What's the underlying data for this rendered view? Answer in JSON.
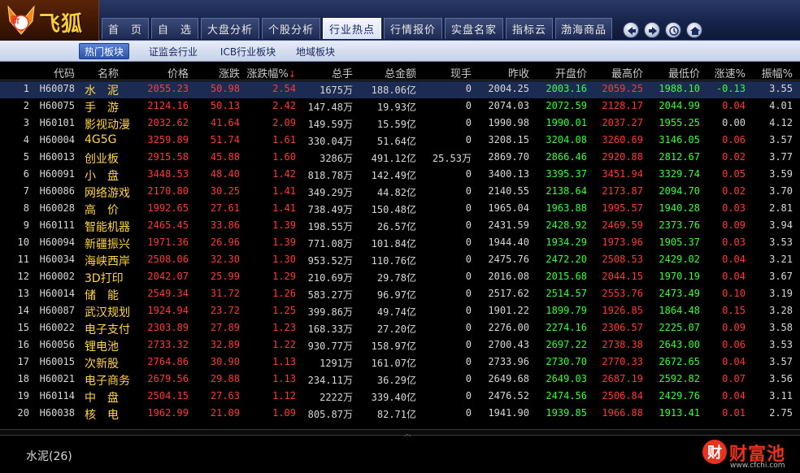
{
  "app": {
    "logo_badge": "新",
    "logo_text": "飞狐"
  },
  "nav": {
    "tabs": [
      "首　页",
      "自　选",
      "大盘分析",
      "个股分析",
      "行业热点",
      "行情报价",
      "实盘名家",
      "指标云",
      "渤海商品"
    ],
    "active_index": 4,
    "buttons": [
      "back-icon",
      "forward-icon",
      "clock-icon",
      "home-icon"
    ]
  },
  "subnav": {
    "tabs": [
      "热门板块",
      "证监会行业",
      "ICB行业板块",
      "地域板块"
    ],
    "active_index": 0
  },
  "table": {
    "columns": [
      "代码",
      "名称",
      "价格",
      "涨跌",
      "涨跌幅%",
      "总手",
      "总金额",
      "现手",
      "昨收",
      "开盘价",
      "最高价",
      "最低价",
      "涨速%",
      "振幅%"
    ],
    "sorted_column": "涨跌幅%",
    "sort_indicator": "↓",
    "rows": [
      {
        "idx": "1",
        "code": "H60078",
        "name": "水　泥",
        "price": "2055.23",
        "chg": "50.98",
        "pct": "2.54",
        "vol": "1675万",
        "amt": "188.06亿",
        "cur": "0",
        "prev": "2004.25",
        "open": "2003.16",
        "high": "2059.25",
        "low": "1988.10",
        "speed": "-0.13",
        "amp": "3.55",
        "open_c": "green",
        "high_c": "red",
        "low_c": "green",
        "speed_c": "green"
      },
      {
        "idx": "2",
        "code": "H60075",
        "name": "手　游",
        "price": "2124.16",
        "chg": "50.13",
        "pct": "2.42",
        "vol": "147.48万",
        "amt": "19.93亿",
        "cur": "0",
        "prev": "2074.03",
        "open": "2072.59",
        "high": "2128.17",
        "low": "2044.99",
        "speed": "0.04",
        "amp": "4.01",
        "open_c": "green",
        "high_c": "red",
        "low_c": "green",
        "speed_c": "red"
      },
      {
        "idx": "3",
        "code": "H60101",
        "name": "影视动漫",
        "price": "2032.62",
        "chg": "41.64",
        "pct": "2.09",
        "vol": "149.59万",
        "amt": "15.59亿",
        "cur": "0",
        "prev": "1990.98",
        "open": "1990.01",
        "high": "2037.27",
        "low": "1955.25",
        "speed": "0.00",
        "amp": "4.12",
        "open_c": "green",
        "high_c": "red",
        "low_c": "green",
        "speed_c": "white"
      },
      {
        "idx": "4",
        "code": "H60004",
        "name": "4G5G",
        "price": "3259.89",
        "chg": "51.74",
        "pct": "1.61",
        "vol": "330.04万",
        "amt": "51.64亿",
        "cur": "0",
        "prev": "3208.15",
        "open": "3204.08",
        "high": "3260.69",
        "low": "3146.05",
        "speed": "0.06",
        "amp": "3.57",
        "open_c": "green",
        "high_c": "red",
        "low_c": "green",
        "speed_c": "red"
      },
      {
        "idx": "5",
        "code": "H60013",
        "name": "创业板",
        "price": "2915.58",
        "chg": "45.88",
        "pct": "1.60",
        "vol": "3286万",
        "amt": "491.12亿",
        "cur": "25.53万",
        "prev": "2869.70",
        "open": "2866.46",
        "high": "2920.88",
        "low": "2812.67",
        "speed": "0.02",
        "amp": "3.77",
        "open_c": "green",
        "high_c": "red",
        "low_c": "green",
        "speed_c": "red"
      },
      {
        "idx": "6",
        "code": "H60091",
        "name": "小　盘",
        "price": "3448.53",
        "chg": "48.40",
        "pct": "1.42",
        "vol": "818.78万",
        "amt": "142.49亿",
        "cur": "0",
        "prev": "3400.13",
        "open": "3395.37",
        "high": "3451.94",
        "low": "3329.74",
        "speed": "0.05",
        "amp": "3.59",
        "open_c": "green",
        "high_c": "red",
        "low_c": "green",
        "speed_c": "red"
      },
      {
        "idx": "7",
        "code": "H60086",
        "name": "网络游戏",
        "price": "2170.80",
        "chg": "30.25",
        "pct": "1.41",
        "vol": "349.29万",
        "amt": "44.82亿",
        "cur": "0",
        "prev": "2140.55",
        "open": "2138.64",
        "high": "2173.87",
        "low": "2094.70",
        "speed": "0.02",
        "amp": "3.70",
        "open_c": "green",
        "high_c": "red",
        "low_c": "green",
        "speed_c": "red"
      },
      {
        "idx": "8",
        "code": "H60028",
        "name": "高　价",
        "price": "1992.65",
        "chg": "27.61",
        "pct": "1.41",
        "vol": "738.49万",
        "amt": "150.48亿",
        "cur": "0",
        "prev": "1965.04",
        "open": "1963.88",
        "high": "1995.57",
        "low": "1940.28",
        "speed": "0.03",
        "amp": "2.81",
        "open_c": "green",
        "high_c": "red",
        "low_c": "green",
        "speed_c": "red"
      },
      {
        "idx": "9",
        "code": "H60111",
        "name": "智能机器",
        "price": "2465.45",
        "chg": "33.86",
        "pct": "1.39",
        "vol": "198.55万",
        "amt": "26.57亿",
        "cur": "0",
        "prev": "2431.59",
        "open": "2428.92",
        "high": "2469.59",
        "low": "2373.76",
        "speed": "0.09",
        "amp": "3.94",
        "open_c": "green",
        "high_c": "red",
        "low_c": "green",
        "speed_c": "red"
      },
      {
        "idx": "10",
        "code": "H60094",
        "name": "新疆振兴",
        "price": "1971.36",
        "chg": "26.96",
        "pct": "1.39",
        "vol": "771.08万",
        "amt": "101.84亿",
        "cur": "0",
        "prev": "1944.40",
        "open": "1934.29",
        "high": "1973.96",
        "low": "1905.37",
        "speed": "0.03",
        "amp": "3.53",
        "open_c": "green",
        "high_c": "red",
        "low_c": "green",
        "speed_c": "red"
      },
      {
        "idx": "11",
        "code": "H60034",
        "name": "海峡西岸",
        "price": "2508.06",
        "chg": "32.30",
        "pct": "1.30",
        "vol": "953.52万",
        "amt": "110.76亿",
        "cur": "0",
        "prev": "2475.76",
        "open": "2472.20",
        "high": "2508.53",
        "low": "2429.02",
        "speed": "0.04",
        "amp": "3.21",
        "open_c": "green",
        "high_c": "red",
        "low_c": "green",
        "speed_c": "red"
      },
      {
        "idx": "12",
        "code": "H60002",
        "name": "3D打印",
        "price": "2042.07",
        "chg": "25.99",
        "pct": "1.29",
        "vol": "210.69万",
        "amt": "29.78亿",
        "cur": "0",
        "prev": "2016.08",
        "open": "2015.68",
        "high": "2044.15",
        "low": "1970.19",
        "speed": "0.04",
        "amp": "3.67",
        "open_c": "green",
        "high_c": "red",
        "low_c": "green",
        "speed_c": "red"
      },
      {
        "idx": "13",
        "code": "H60014",
        "name": "储　能",
        "price": "2549.34",
        "chg": "31.72",
        "pct": "1.26",
        "vol": "583.27万",
        "amt": "96.97亿",
        "cur": "0",
        "prev": "2517.62",
        "open": "2514.57",
        "high": "2553.76",
        "low": "2473.49",
        "speed": "0.10",
        "amp": "3.19",
        "open_c": "green",
        "high_c": "red",
        "low_c": "green",
        "speed_c": "red"
      },
      {
        "idx": "14",
        "code": "H60087",
        "name": "武汉规划",
        "price": "1924.94",
        "chg": "23.72",
        "pct": "1.25",
        "vol": "399.86万",
        "amt": "49.74亿",
        "cur": "0",
        "prev": "1901.22",
        "open": "1899.79",
        "high": "1926.85",
        "low": "1864.48",
        "speed": "0.15",
        "amp": "3.28",
        "open_c": "green",
        "high_c": "red",
        "low_c": "green",
        "speed_c": "red"
      },
      {
        "idx": "15",
        "code": "H60022",
        "name": "电子支付",
        "price": "2303.89",
        "chg": "27.89",
        "pct": "1.23",
        "vol": "168.33万",
        "amt": "27.20亿",
        "cur": "0",
        "prev": "2276.00",
        "open": "2274.16",
        "high": "2306.57",
        "low": "2225.07",
        "speed": "0.09",
        "amp": "3.58",
        "open_c": "green",
        "high_c": "red",
        "low_c": "green",
        "speed_c": "red"
      },
      {
        "idx": "16",
        "code": "H60056",
        "name": "锂电池",
        "price": "2733.32",
        "chg": "32.89",
        "pct": "1.22",
        "vol": "930.77万",
        "amt": "158.97亿",
        "cur": "0",
        "prev": "2700.43",
        "open": "2697.22",
        "high": "2738.38",
        "low": "2643.00",
        "speed": "0.06",
        "amp": "3.53",
        "open_c": "green",
        "high_c": "red",
        "low_c": "green",
        "speed_c": "red"
      },
      {
        "idx": "17",
        "code": "H60015",
        "name": "次新股",
        "price": "2764.86",
        "chg": "30.90",
        "pct": "1.13",
        "vol": "1291万",
        "amt": "161.07亿",
        "cur": "0",
        "prev": "2733.96",
        "open": "2730.70",
        "high": "2770.33",
        "low": "2672.65",
        "speed": "0.04",
        "amp": "3.57",
        "open_c": "green",
        "high_c": "red",
        "low_c": "green",
        "speed_c": "red"
      },
      {
        "idx": "18",
        "code": "H60021",
        "name": "电子商务",
        "price": "2679.56",
        "chg": "29.88",
        "pct": "1.13",
        "vol": "234.11万",
        "amt": "36.29亿",
        "cur": "0",
        "prev": "2649.68",
        "open": "2649.03",
        "high": "2687.19",
        "low": "2592.82",
        "speed": "0.07",
        "amp": "3.56",
        "open_c": "green",
        "high_c": "red",
        "low_c": "green",
        "speed_c": "red"
      },
      {
        "idx": "19",
        "code": "H60114",
        "name": "中　盘",
        "price": "2504.15",
        "chg": "27.63",
        "pct": "1.12",
        "vol": "2222万",
        "amt": "339.40亿",
        "cur": "0",
        "prev": "2476.52",
        "open": "2474.56",
        "high": "2506.84",
        "low": "2429.76",
        "speed": "0.04",
        "amp": "3.11",
        "open_c": "green",
        "high_c": "red",
        "low_c": "green",
        "speed_c": "red"
      },
      {
        "idx": "20",
        "code": "H60038",
        "name": "核　电",
        "price": "1962.99",
        "chg": "21.09",
        "pct": "1.09",
        "vol": "805.87万",
        "amt": "82.71亿",
        "cur": "0",
        "prev": "1941.90",
        "open": "1939.85",
        "high": "1966.88",
        "low": "1913.41",
        "speed": "0.01",
        "amp": "2.75",
        "open_c": "green",
        "high_c": "red",
        "low_c": "green",
        "speed_c": "red"
      }
    ]
  },
  "status": {
    "selected_label": "水泥(26)"
  },
  "brand": {
    "logo": "财",
    "name": "财富池",
    "url": "www.cfchi.com"
  },
  "colors": {
    "up": "#ff3a3a",
    "down": "#3aff3a",
    "name": "#ffd54a",
    "selected_row": "#1c2b52"
  }
}
